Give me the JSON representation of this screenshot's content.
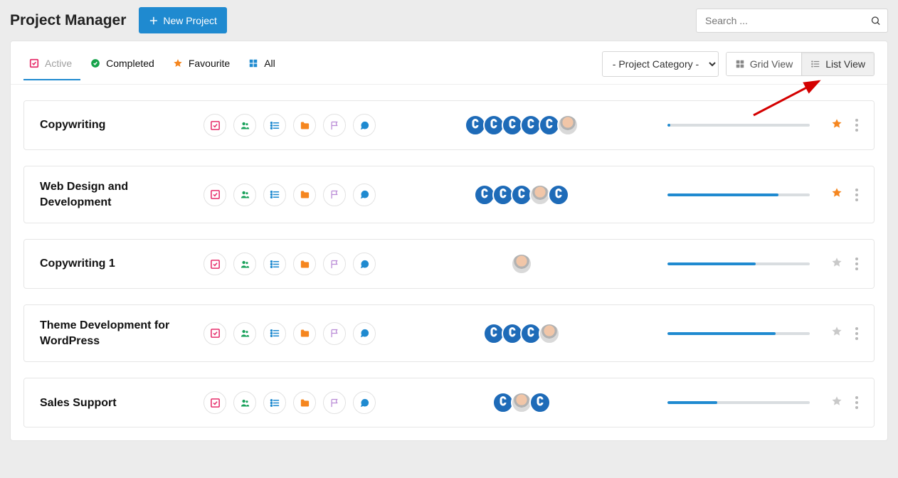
{
  "header": {
    "title": "Project Manager",
    "new_project_label": "New Project"
  },
  "search": {
    "placeholder": "Search ...",
    "value": ""
  },
  "tabs": [
    {
      "label": "Active",
      "icon": "check-square",
      "color": "#e62e6b",
      "active": true
    },
    {
      "label": "Completed",
      "icon": "check-circle",
      "color": "#16a34a",
      "active": false
    },
    {
      "label": "Favourite",
      "icon": "star",
      "color": "#f5861f",
      "active": false
    },
    {
      "label": "All",
      "icon": "grid",
      "color": "#1f8ad0",
      "active": false
    }
  ],
  "category_select": {
    "selected": "- Project Category -"
  },
  "view_toggle": {
    "grid": "Grid View",
    "list": "List View",
    "active": "list"
  },
  "row_icons": [
    {
      "name": "check-square-icon",
      "color": "#e62e6b"
    },
    {
      "name": "users-icon",
      "color": "#18a15a"
    },
    {
      "name": "list-icon",
      "color": "#1f8ad0"
    },
    {
      "name": "folder-icon",
      "color": "#f5861f"
    },
    {
      "name": "flag-icon",
      "color": "#b98ad6"
    },
    {
      "name": "message-icon",
      "color": "#1f8ad0"
    }
  ],
  "projects": [
    {
      "name": "Copywriting",
      "avatars": [
        "grav",
        "grav",
        "grav",
        "grav",
        "grav",
        "photo"
      ],
      "progress": 2,
      "favourite": true
    },
    {
      "name": "Web Design and Development",
      "avatars": [
        "grav",
        "grav",
        "grav",
        "photo",
        "grav"
      ],
      "progress": 78,
      "favourite": true
    },
    {
      "name": "Copywriting 1",
      "avatars": [
        "photo"
      ],
      "progress": 62,
      "favourite": false
    },
    {
      "name": "Theme Development for WordPress",
      "avatars": [
        "grav",
        "grav",
        "grav",
        "photo"
      ],
      "progress": 76,
      "favourite": false
    },
    {
      "name": "Sales Support",
      "avatars": [
        "grav",
        "photo",
        "grav"
      ],
      "progress": 35,
      "favourite": false
    }
  ],
  "annotation": {
    "arrow_points_to": "list-view-button"
  }
}
